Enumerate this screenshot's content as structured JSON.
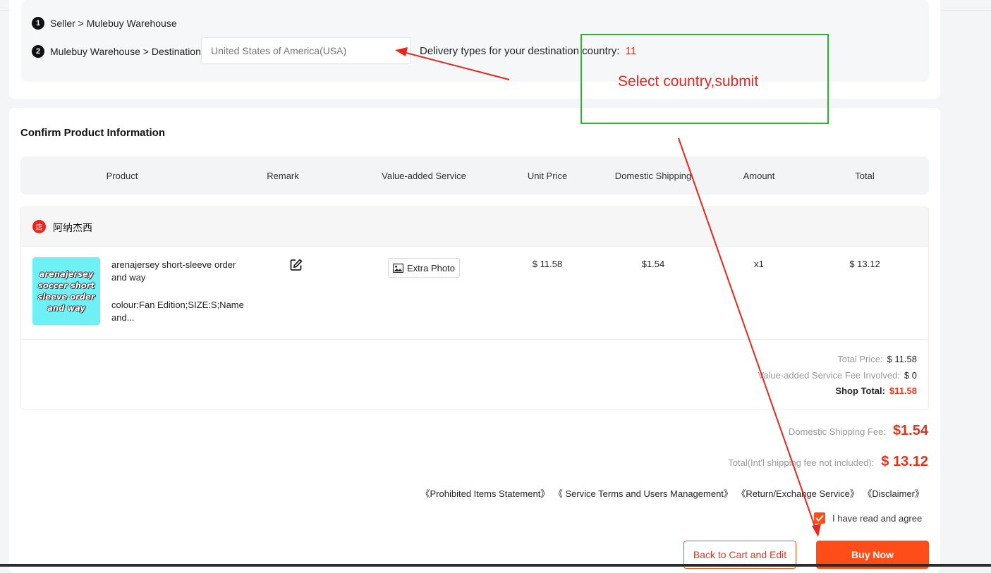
{
  "route": {
    "step1_num": "1",
    "step1_label": "Seller > Mulebuy Warehouse",
    "step2_num": "2",
    "step2_label": "Mulebuy Warehouse > Destination",
    "destination_placeholder": "United States of America(USA)",
    "delivery_label": "Delivery types for your destination country:",
    "delivery_count": "11"
  },
  "annotation": {
    "text": "Select country,submit",
    "box_color": "#2bb32b",
    "arrow_color": "#e8261c"
  },
  "confirm": {
    "title": "Confirm Product Information",
    "columns": [
      "Product",
      "Remark",
      "Value-added Service",
      "Unit Price",
      "Domestic Shipping",
      "Amount",
      "Total"
    ]
  },
  "shop": {
    "icon_glyph": "店",
    "name": "阿纳杰西",
    "item": {
      "thumb_text": "arenajersey soccer short sleeve order and way",
      "name": "arenajersey short-sleeve order and way",
      "attributes": "colour:Fan Edition;SIZE:S;Name and...",
      "extra_service": "Extra Photo",
      "unit_price": "$ 11.58",
      "domestic_shipping": "$1.54",
      "amount": "x1",
      "total": "$ 13.12"
    },
    "summary": {
      "total_price_label": "Total Price:",
      "total_price": "$ 11.58",
      "vas_label": "Value-added Service Fee Involved:",
      "vas": "$ 0",
      "shop_total_label": "Shop Total:",
      "shop_total": "$11.58"
    }
  },
  "fees": {
    "domestic_label": "Domestic Shipping Fee:",
    "domestic_value": "$1.54",
    "total_label": "Total(Int'l shipping fee not included):",
    "total_value": "$ 13.12"
  },
  "links": [
    "《Prohibited Items Statement》",
    "《 Service Terms and Users Management》",
    "《Return/Exchange Service》",
    "《Disclaimer》"
  ],
  "agree_label": "I have read and agree",
  "buttons": {
    "back": "Back to Cart and Edit",
    "buy": "Buy Now"
  },
  "colors": {
    "accent": "#ff4d1a",
    "price_red": "#e2341b"
  }
}
